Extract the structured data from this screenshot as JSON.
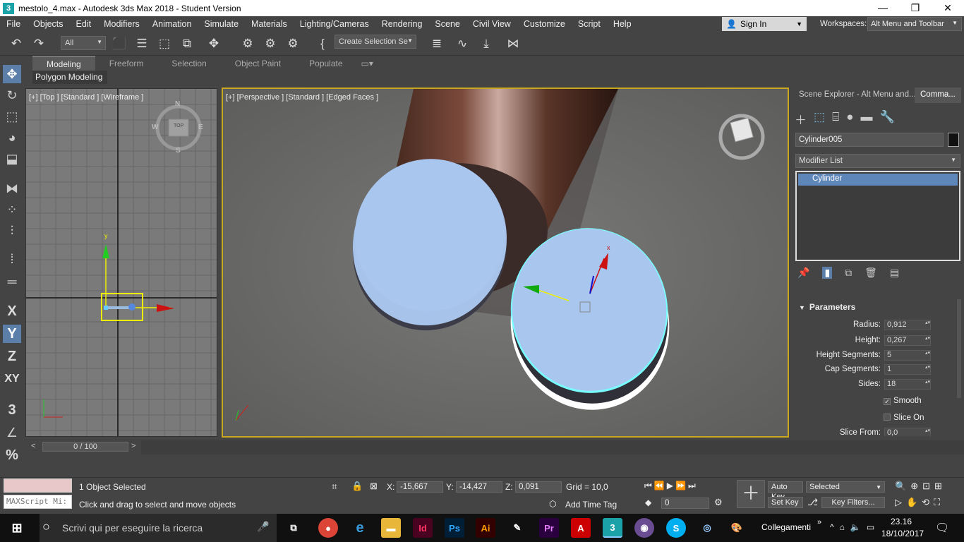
{
  "window": {
    "app_icon": "3",
    "title": "mestolo_4.max - Autodesk 3ds Max 2018 - Student Version",
    "minimize": "—",
    "maximize": "❐",
    "close": "✕"
  },
  "menu": [
    "File",
    "Objects",
    "Edit",
    "Modifiers",
    "Animation",
    "Simulate",
    "Materials",
    "Lighting/Cameras",
    "Rendering",
    "Scene",
    "Civil View",
    "Customize",
    "Script",
    "Help"
  ],
  "signin": {
    "label": "Sign In",
    "icon": "user-icon"
  },
  "workspaces": {
    "label": "Workspaces:",
    "value": "Alt Menu and Toolbar"
  },
  "toolbar": {
    "filter_value": "All",
    "selection_set_value": "Create Selection Se"
  },
  "ribbon": {
    "tabs": [
      "Modeling",
      "Freeform",
      "Selection",
      "Object Paint",
      "Populate"
    ],
    "active": "Modeling",
    "panel": "Polygon Modeling"
  },
  "left_commands": {
    "x": "X",
    "y": "Y",
    "z": "Z",
    "xy": "XY",
    "snap3": "3",
    "percent": "%"
  },
  "viewports": {
    "top": {
      "label": "[+] [Top ] [Standard ] [Wireframe ]",
      "viewcube": "TOP",
      "compass": {
        "n": "N",
        "s": "S",
        "e": "E",
        "w": "W"
      },
      "axis_y": "y"
    },
    "perspective": {
      "label": "[+] [Perspective ] [Standard ] [Edged Faces ]",
      "gizmo_x": "x"
    }
  },
  "command_panel": {
    "tabs": [
      "Scene Explorer - Alt Menu and...",
      "Comma..."
    ],
    "object_name": "Cylinder005",
    "object_color": "#111111",
    "modifier_list": "Modifier List",
    "stack": [
      "Cylinder"
    ],
    "rollout_title": "Parameters",
    "params": [
      {
        "label": "Radius:",
        "value": "0,912"
      },
      {
        "label": "Height:",
        "value": "0,267"
      },
      {
        "label": "Height Segments:",
        "value": "5"
      },
      {
        "label": "Cap Segments:",
        "value": "1"
      },
      {
        "label": "Sides:",
        "value": "18"
      }
    ],
    "smooth": {
      "label": "Smooth",
      "checked": true
    },
    "slice_on": {
      "label": "Slice On",
      "checked": false
    },
    "slice_from": {
      "label": "Slice From:",
      "value": "0,0"
    }
  },
  "timeline": {
    "slider": "0 / 100",
    "prev": "<",
    "next": ">"
  },
  "status": {
    "maxscript": "MAXScript Mi:",
    "selected": "1 Object Selected",
    "prompt": "Click and drag to select and move objects",
    "x_label": "X:",
    "x": "-15,667",
    "y_label": "Y:",
    "y": "-14,427",
    "z_label": "Z:",
    "z": "0,091",
    "grid": "Grid = 10,0",
    "add_time_tag": "Add Time Tag",
    "auto_key": "Auto Key",
    "set_key": "Set Key",
    "selected_value": "Selected",
    "key_filters": "Key Filters...",
    "frame": "0"
  },
  "taskbar": {
    "search_placeholder": "Scrivi qui per eseguire la ricerca",
    "collegamenti": "Collegamenti",
    "time": "23.16",
    "date": "18/10/2017"
  }
}
